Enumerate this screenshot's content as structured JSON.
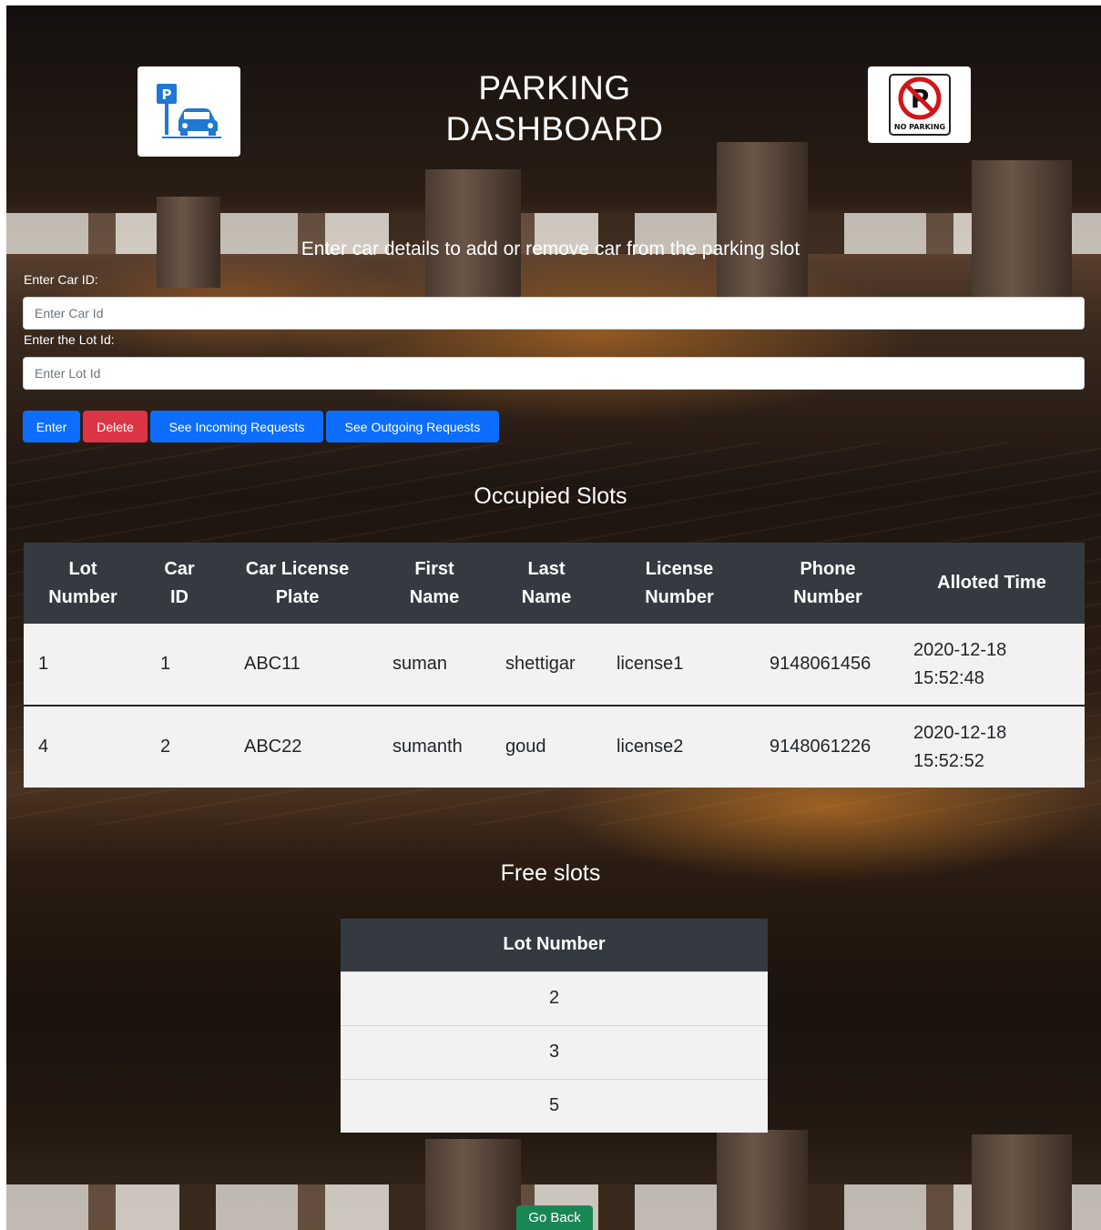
{
  "header": {
    "title_line1": "PARKING",
    "title_line2": "DASHBOARD",
    "subtitle": "Enter car details to add or remove car from the parking slot",
    "logo_left_icon": "parking-sign-car-icon",
    "logo_right_icon": "no-parking-sign-icon",
    "logo_right_text": "NO PARKING",
    "logo_left_letter": "P"
  },
  "form": {
    "car_id_label": "Enter Car ID:",
    "car_id_placeholder": "Enter Car Id",
    "lot_id_label": "Enter the Lot Id:",
    "lot_id_placeholder": "Enter Lot Id"
  },
  "buttons": {
    "enter": "Enter",
    "delete": "Delete",
    "incoming": "See Incoming Requests",
    "outgoing": "See Outgoing Requests",
    "go_back": "Go Back"
  },
  "occupied": {
    "title": "Occupied Slots",
    "headers": {
      "lot_1": "Lot",
      "lot_2": "Number",
      "car_1": "Car",
      "car_2": "ID",
      "plate_1": "Car License",
      "plate_2": "Plate",
      "first_1": "First",
      "first_2": "Name",
      "last_1": "Last",
      "last_2": "Name",
      "license_1": "License",
      "license_2": "Number",
      "phone_1": "Phone",
      "phone_2": "Number",
      "time": "Alloted Time"
    },
    "rows": [
      {
        "lot": "1",
        "car": "1",
        "plate": "ABC11",
        "first": "suman",
        "last": "shettigar",
        "license": "license1",
        "phone": "9148061456",
        "date": "2020-12-18",
        "time": "15:52:48"
      },
      {
        "lot": "4",
        "car": "2",
        "plate": "ABC22",
        "first": "sumanth",
        "last": "goud",
        "license": "license2",
        "phone": "9148061226",
        "date": "2020-12-18",
        "time": "15:52:52"
      }
    ]
  },
  "free": {
    "title": "Free slots",
    "header": "Lot Number",
    "rows": [
      "2",
      "3",
      "5"
    ]
  },
  "colors": {
    "primary": "#0d6efd",
    "danger": "#dc3545",
    "success": "#198754",
    "table_header": "#343a40"
  }
}
